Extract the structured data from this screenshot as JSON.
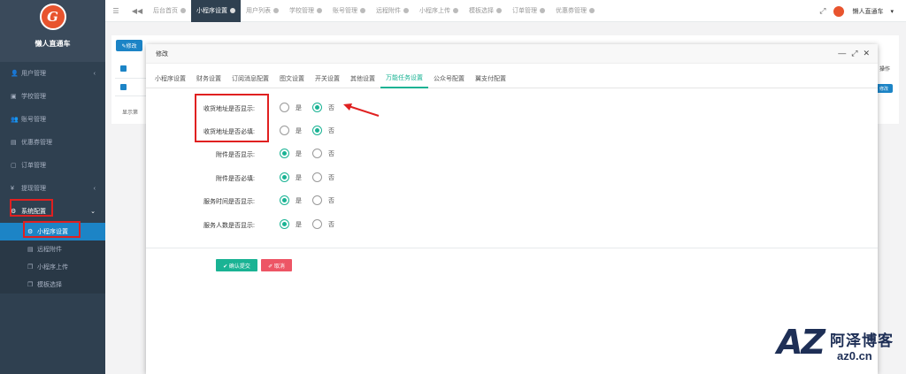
{
  "brand": {
    "logo_text": "G",
    "name": "懒人直通车"
  },
  "sidebar": {
    "items": [
      {
        "icon": "user-icon",
        "glyph": "👤",
        "label": "用户管理",
        "caret": "‹"
      },
      {
        "icon": "book-icon",
        "glyph": "▣",
        "label": "学校管理",
        "caret": ""
      },
      {
        "icon": "users-icon",
        "glyph": "👥",
        "label": "账号管理",
        "caret": ""
      },
      {
        "icon": "ticket-icon",
        "glyph": "▤",
        "label": "优惠券管理",
        "caret": ""
      },
      {
        "icon": "file-icon",
        "glyph": "▢",
        "label": "订单管理",
        "caret": ""
      },
      {
        "icon": "yen-icon",
        "glyph": "¥",
        "label": "提现管理",
        "caret": "‹"
      },
      {
        "icon": "gear-icon",
        "glyph": "⚙",
        "label": "系统配置",
        "caret": "⌄"
      }
    ],
    "sub_items": [
      {
        "icon": "gear-icon",
        "glyph": "⚙",
        "label": "小程序设置",
        "active": true
      },
      {
        "icon": "file-icon",
        "glyph": "▤",
        "label": "远程附件"
      },
      {
        "icon": "copy-icon",
        "glyph": "❐",
        "label": "小程序上传"
      },
      {
        "icon": "copy-icon",
        "glyph": "❐",
        "label": "模板选择"
      }
    ]
  },
  "topbar": {
    "tabs": [
      "后台首页",
      "小程序设置",
      "用户列表",
      "学校管理",
      "账号管理",
      "远程附件",
      "小程序上传",
      "模板选择",
      "订单管理",
      "优惠券管理"
    ],
    "active_tab": 1,
    "user_name": "懒人直通车",
    "user_caret": "▾"
  },
  "background": {
    "edit_button": "✎修改",
    "display_text": "显示第",
    "right_head": "操作",
    "right_button": "修改"
  },
  "modal": {
    "title": "修改",
    "controls": {
      "minimize": "—",
      "maximize": "⤢",
      "close": "✕"
    },
    "tabs": [
      "小程序设置",
      "财务设置",
      "订阅消息配置",
      "图文设置",
      "开关设置",
      "其他设置",
      "万能任务设置",
      "公众号配置",
      "翼支付配置"
    ],
    "active_tab": 6,
    "fields": [
      {
        "label": "收货地址是否显示:",
        "yes": "是",
        "no": "否",
        "selected": "no"
      },
      {
        "label": "收货地址是否必填:",
        "yes": "是",
        "no": "否",
        "selected": "no"
      },
      {
        "label": "附件是否显示:",
        "yes": "是",
        "no": "否",
        "selected": "yes"
      },
      {
        "label": "附件是否必填:",
        "yes": "是",
        "no": "否",
        "selected": "yes"
      },
      {
        "label": "服务时间是否显示:",
        "yes": "是",
        "no": "否",
        "selected": "yes"
      },
      {
        "label": "服务人数是否显示:",
        "yes": "是",
        "no": "否",
        "selected": "yes"
      }
    ],
    "submit_label": "✔ 确认提交",
    "cancel_label": "✐ 取消"
  },
  "colors": {
    "accent": "#1ab394",
    "sidebar": "#2f4050",
    "active_blue": "#1c84c6",
    "danger": "#ed5565",
    "annotation_red": "#e02020"
  },
  "watermark": {
    "mark": "AZ",
    "name": "阿泽博客",
    "url": "az0.cn"
  }
}
